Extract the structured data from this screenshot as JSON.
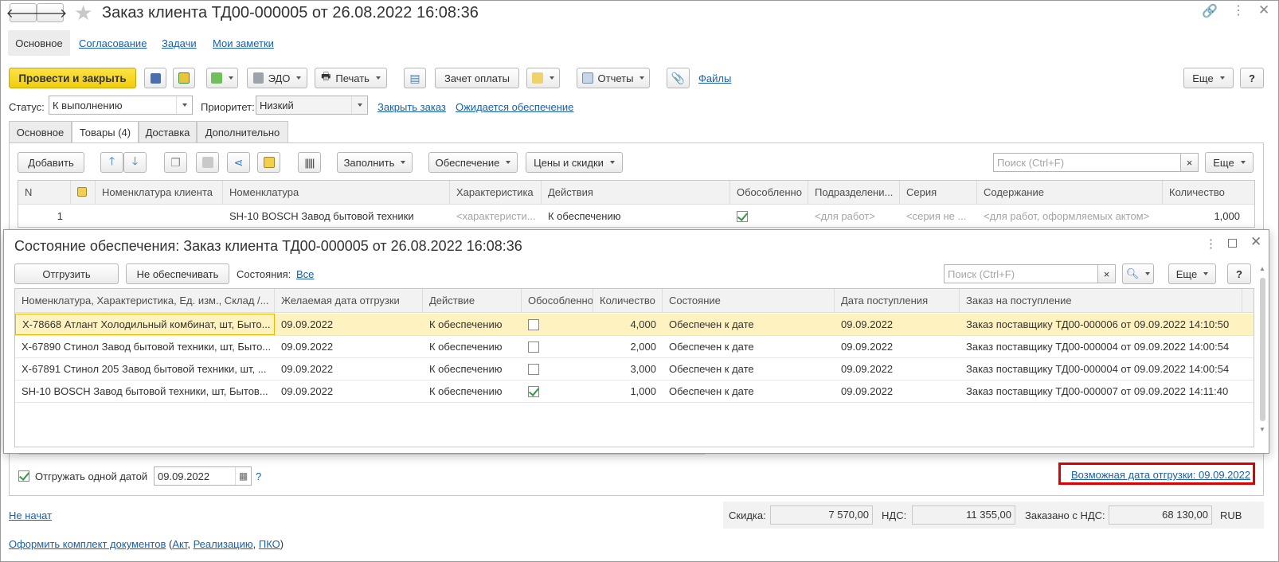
{
  "window": {
    "title": "Заказ клиента ТД00-000005 от 26.08.2022 16:08:36"
  },
  "nav": [
    "Основное",
    "Согласование",
    "Задачи",
    "Мои заметки"
  ],
  "toolbar": {
    "post_close": "Провести и закрыть",
    "edo": "ЭДО",
    "print": "Печать",
    "offset": "Зачет оплаты",
    "reports": "Отчеты",
    "files": "Файлы",
    "more": "Еще",
    "help": "?"
  },
  "status": {
    "label": "Статус:",
    "value": "К выполнению",
    "priority_label": "Приоритет:",
    "priority_value": "Низкий",
    "close_order": "Закрыть заказ",
    "awaiting": "Ожидается обеспечение"
  },
  "tabs": [
    "Основное",
    "Товары (4)",
    "Доставка",
    "Дополнительно"
  ],
  "goods_toolbar": {
    "add": "Добавить",
    "fill": "Заполнить",
    "provision": "Обеспечение",
    "prices": "Цены и скидки",
    "search_placeholder": "Поиск (Ctrl+F)",
    "clear": "×",
    "more": "Еще"
  },
  "goods_table": {
    "headers": [
      "N",
      "",
      "Номенклатура клиента",
      "Номенклатура",
      "Характеристика",
      "Действия",
      "Обособленно",
      "Подразделени...",
      "Серия",
      "Содержание",
      "Количество"
    ],
    "row": {
      "n": "1",
      "client_item": "",
      "item": "SH-10 BOSCH Завод бытовой техники",
      "char": "<характеристи...",
      "action": "К обеспечению",
      "separate": true,
      "dept": "<для работ>",
      "series": "<серия не ...",
      "content": "<для работ, оформляемых актом>",
      "qty": "1,000"
    }
  },
  "popup": {
    "title": "Состояние обеспечения: Заказ клиента ТД00-000005 от 26.08.2022 16:08:36",
    "ship": "Отгрузить",
    "no_provide": "Не обеспечивать",
    "states_label": "Состояния:",
    "states_value": "Все",
    "search_placeholder": "Поиск (Ctrl+F)",
    "clear": "×",
    "more": "Еще",
    "help": "?",
    "headers": [
      "Номенклатура, Характеристика, Ед. изм., Склад /...",
      "Желаемая дата отгрузки",
      "Действие",
      "Обособленно",
      "Количество",
      "Состояние",
      "Дата поступления",
      "Заказ на поступление"
    ],
    "rows": [
      {
        "item": "X-78668 Атлант Холодильный комбинат, шт, Быто...",
        "date": "09.09.2022",
        "action": "К обеспечению",
        "separate": false,
        "qty": "4,000",
        "state": "Обеспечен к дате",
        "arrival": "09.09.2022",
        "order": "Заказ поставщику ТД00-000006 от 09.09.2022 14:10:50"
      },
      {
        "item": "X-67890 Стинол Завод бытовой техники, шт, Быто...",
        "date": "09.09.2022",
        "action": "К обеспечению",
        "separate": false,
        "qty": "2,000",
        "state": "Обеспечен к дате",
        "arrival": "09.09.2022",
        "order": "Заказ поставщику ТД00-000004 от 09.09.2022 14:00:54"
      },
      {
        "item": "X-67891 Стинол 205 Завод бытовой техники, шт, ...",
        "date": "09.09.2022",
        "action": "К обеспечению",
        "separate": false,
        "qty": "3,000",
        "state": "Обеспечен к дате",
        "arrival": "09.09.2022",
        "order": "Заказ поставщику ТД00-000004 от 09.09.2022 14:00:54"
      },
      {
        "item": "SH-10 BOSCH Завод бытовой техники, шт, Бытов...",
        "date": "09.09.2022",
        "action": "К обеспечению",
        "separate": true,
        "qty": "1,000",
        "state": "Обеспечен к дате",
        "arrival": "09.09.2022",
        "order": "Заказ поставщику ТД00-000007 от 09.09.2022 14:11:40"
      }
    ]
  },
  "ship_options": {
    "single_date_label": "Отгружать одной датой",
    "single_date_checked": true,
    "date": "09.09.2022",
    "help": "?",
    "possible_date": "Возможная дата отгрузки: 09.09.2022"
  },
  "footer": {
    "state_link": "Не начат",
    "discount_label": "Скидка:",
    "discount": "7 570,00",
    "vat_label": "НДС:",
    "vat": "11 355,00",
    "total_label": "Заказано с НДС:",
    "total": "68 130,00",
    "currency": "RUB",
    "docs_prefix": "Оформить комплект документов (",
    "docs_act": "Акт",
    "docs_sep1": ", ",
    "docs_sale": "Реализацию",
    "docs_sep2": ", ",
    "docs_pko": "ПКО",
    "docs_suffix": ")"
  },
  "colors": {
    "primary": "#f6d80e",
    "accent_link": "#1a5fad",
    "highlight": "#fff2c1",
    "red_frame": "#e00000"
  }
}
